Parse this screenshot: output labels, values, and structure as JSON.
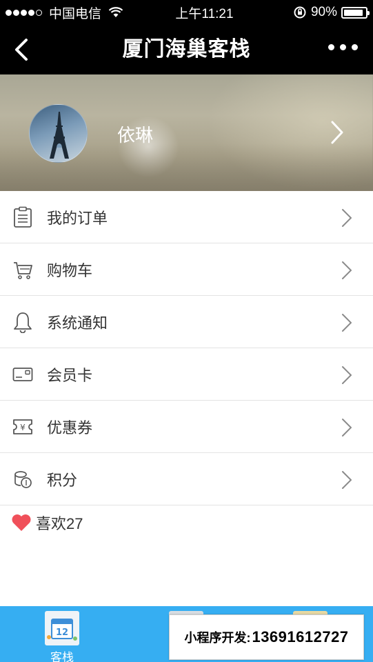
{
  "status_bar": {
    "carrier": "中国电信",
    "time": "上午11:21",
    "battery": "90%",
    "battery_level": 0.9
  },
  "nav": {
    "title": "厦门海巢客栈",
    "back_icon": "chevron-left-icon",
    "more_icon": "more-dots-icon"
  },
  "profile": {
    "name": "依琳"
  },
  "menu": [
    {
      "label": "我的订单",
      "icon": "order-list-icon"
    },
    {
      "label": "购物车",
      "icon": "shopping-cart-icon"
    },
    {
      "label": "系统通知",
      "icon": "bell-icon"
    },
    {
      "label": "会员卡",
      "icon": "member-card-icon"
    },
    {
      "label": "优惠券",
      "icon": "coupon-icon"
    },
    {
      "label": "积分",
      "icon": "coins-icon"
    }
  ],
  "likes": {
    "label": "喜欢27",
    "icon": "heart-icon",
    "color": "#f0505a"
  },
  "tab_bar": {
    "color": "#36aef2",
    "tabs": [
      {
        "label": "客栈",
        "icon": "calendar-icon"
      }
    ]
  },
  "dev_banner": {
    "prefix": "小程序开发:",
    "phone": "13691612727"
  }
}
